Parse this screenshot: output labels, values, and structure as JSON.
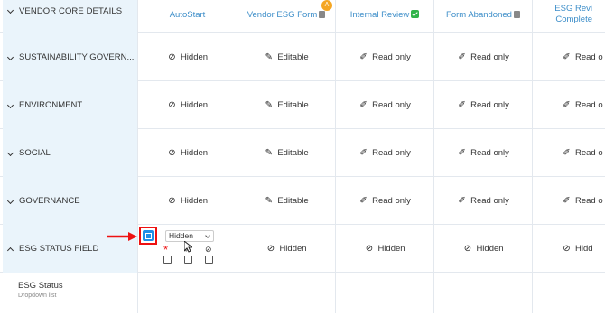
{
  "header": {
    "first": "VENDOR CORE DETAILS",
    "columns": [
      {
        "label": "AutoStart",
        "icon": ""
      },
      {
        "label": "Vendor ESG Form",
        "icon": "document-icon",
        "badge": "A"
      },
      {
        "label": "Internal Review",
        "icon": "checkmark-icon"
      },
      {
        "label": "Form Abandoned",
        "icon": "document-icon"
      },
      {
        "label_line1": "ESG Revi",
        "label_line2": "Complete"
      }
    ]
  },
  "rows": [
    {
      "label": "SUSTAINABILITY GOVERN...",
      "cells": [
        "Hidden",
        "Editable",
        "Read only",
        "Read only",
        "Read o"
      ]
    },
    {
      "label": "ENVIRONMENT",
      "cells": [
        "Hidden",
        "Editable",
        "Read only",
        "Read only",
        "Read o"
      ]
    },
    {
      "label": "SOCIAL",
      "cells": [
        "Hidden",
        "Editable",
        "Read only",
        "Read only",
        "Read o"
      ]
    },
    {
      "label": "GOVERNANCE",
      "cells": [
        "Hidden",
        "Editable",
        "Read only",
        "Read only",
        "Read o"
      ]
    }
  ],
  "status_row": {
    "label": "ESG STATUS FIELD",
    "select_value": "Hidden",
    "required_mark": "*",
    "cells": [
      "Hidden",
      "Hidden",
      "Hidden",
      "Hidd"
    ]
  },
  "field_row": {
    "title": "ESG Status",
    "subtitle": "Dropdown list"
  },
  "colors": {
    "accent": "#3d8ec9",
    "row_bg": "#eaf4fb",
    "highlight": "#e11111",
    "button": "#1f8fe6"
  }
}
